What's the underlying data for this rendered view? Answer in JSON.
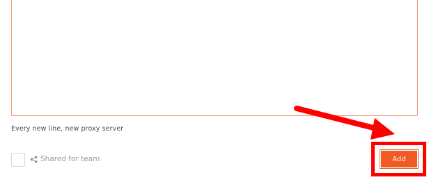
{
  "proxy_form": {
    "textarea_value": "",
    "hint": "Every new line, new proxy server",
    "shared_checked": false,
    "shared_label": "Shared for team",
    "add_label": "Add"
  },
  "colors": {
    "accent": "#f15a22",
    "textarea_border": "#f09a70",
    "annotation": "#ff0000"
  }
}
